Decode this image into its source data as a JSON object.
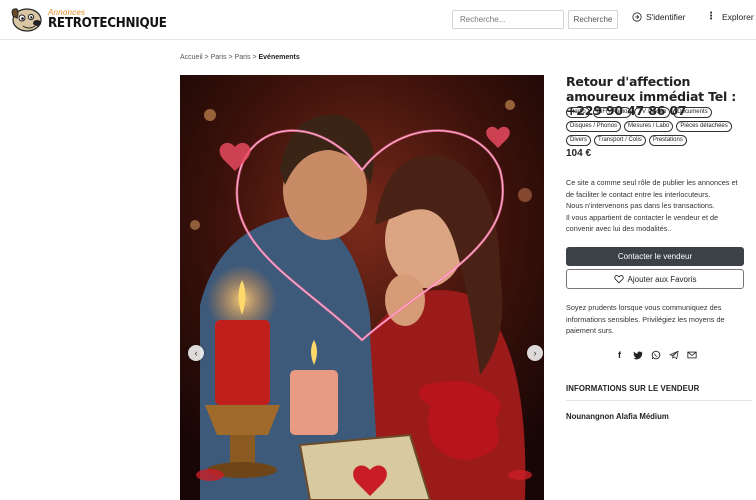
{
  "header": {
    "logo_small": "Annonces",
    "logo_big": "RETROTECHNIQUE",
    "search_placeholder": "Recherche...",
    "search_button": "Recherche",
    "login_label": "S'identifier",
    "explore_label": "Explorer"
  },
  "breadcrumb": {
    "items": [
      "Accueil",
      "Paris",
      "Paris"
    ],
    "separator": ">",
    "current": "Evénements"
  },
  "listing": {
    "title": "Retour d'affection amoureux immédiat Tel : +229 90 47 86 07",
    "tags": [
      "Radio",
      "HiFi / Audio",
      "TV / Vidéo",
      "Documents",
      "Disques / Phonos",
      "Mesures / Labo",
      "Pièces détachées",
      "Divers",
      "Transport / Colis",
      "Prestations"
    ],
    "price": "104 €",
    "disclaimer_lines": [
      "Ce site a comme seul rôle de publier les annonces et",
      "de faciliter le contact entre les interlocuteurs.",
      "Nous n'intervenons pas dans les transactions.",
      "Il vous appartient de contacter le vendeur et de",
      "convenir avec lui des modalités.."
    ],
    "contact_button": "Contacter le vendeur",
    "favorite_button": "Ajouter aux Favoris",
    "caution_lines": [
      "Soyez prudents lorsque vous communiquez des",
      "informations sensibles. Privilégiez les moyens de",
      "paiement surs."
    ],
    "share_icons": [
      "facebook-icon",
      "twitter-icon",
      "whatsapp-icon",
      "telegram-icon",
      "email-icon"
    ]
  },
  "seller": {
    "heading": "INFORMATIONS SUR LE VENDEUR",
    "name": "Nounangnon Alafia Médium"
  },
  "colors": {
    "accent_orange": "#e08a1e",
    "contact_button_bg": "#3b4146",
    "hero_bg": "#2a0d0a"
  }
}
